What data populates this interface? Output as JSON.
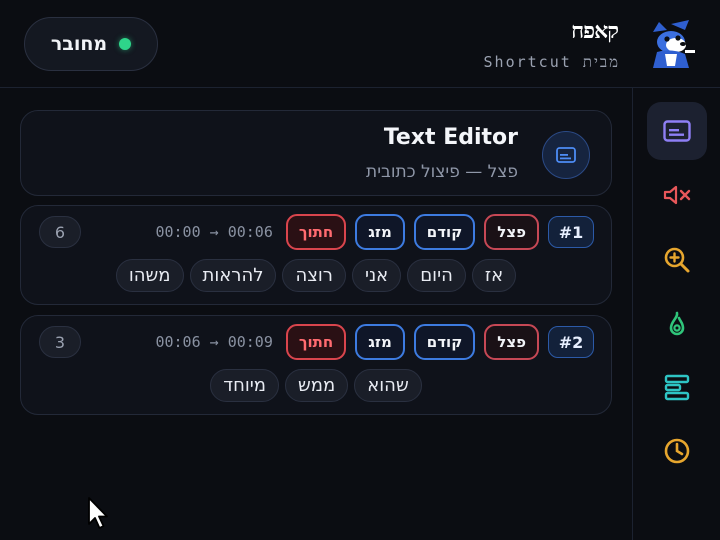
{
  "header": {
    "connection_label": "מחובר",
    "brand_name": "קאפח",
    "brand_sub": "מבית Shortcut"
  },
  "colors": {
    "background": "#0b0d12",
    "connected": "#2ed58a",
    "accent_blue": "#3d7be0",
    "accent_red": "#d9454d"
  },
  "sidebar": {
    "items": [
      {
        "icon": "subtitles-icon",
        "active": true
      },
      {
        "icon": "mute-icon"
      },
      {
        "icon": "zoom-in-icon"
      },
      {
        "icon": "fire-icon"
      },
      {
        "icon": "align-icon"
      },
      {
        "icon": "clock-icon"
      }
    ]
  },
  "editor": {
    "title": "Text Editor",
    "subtitle": "פצל — פיצול כתובית"
  },
  "segments": [
    {
      "num": "#1",
      "actions": {
        "split": "פצל",
        "prev": "קודם",
        "merge": "מזג",
        "trim": "חתוך"
      },
      "time": "00:00 → 00:06",
      "count": "6",
      "words": [
        "אז",
        "היום",
        "אני",
        "רוצה",
        "להראות",
        "משהו"
      ]
    },
    {
      "num": "#2",
      "actions": {
        "split": "פצל",
        "prev": "קודם",
        "merge": "מזג",
        "trim": "חתוך"
      },
      "time": "00:06 → 00:09",
      "count": "3",
      "words": [
        "שהוא",
        "ממש",
        "מיוחד"
      ]
    }
  ]
}
